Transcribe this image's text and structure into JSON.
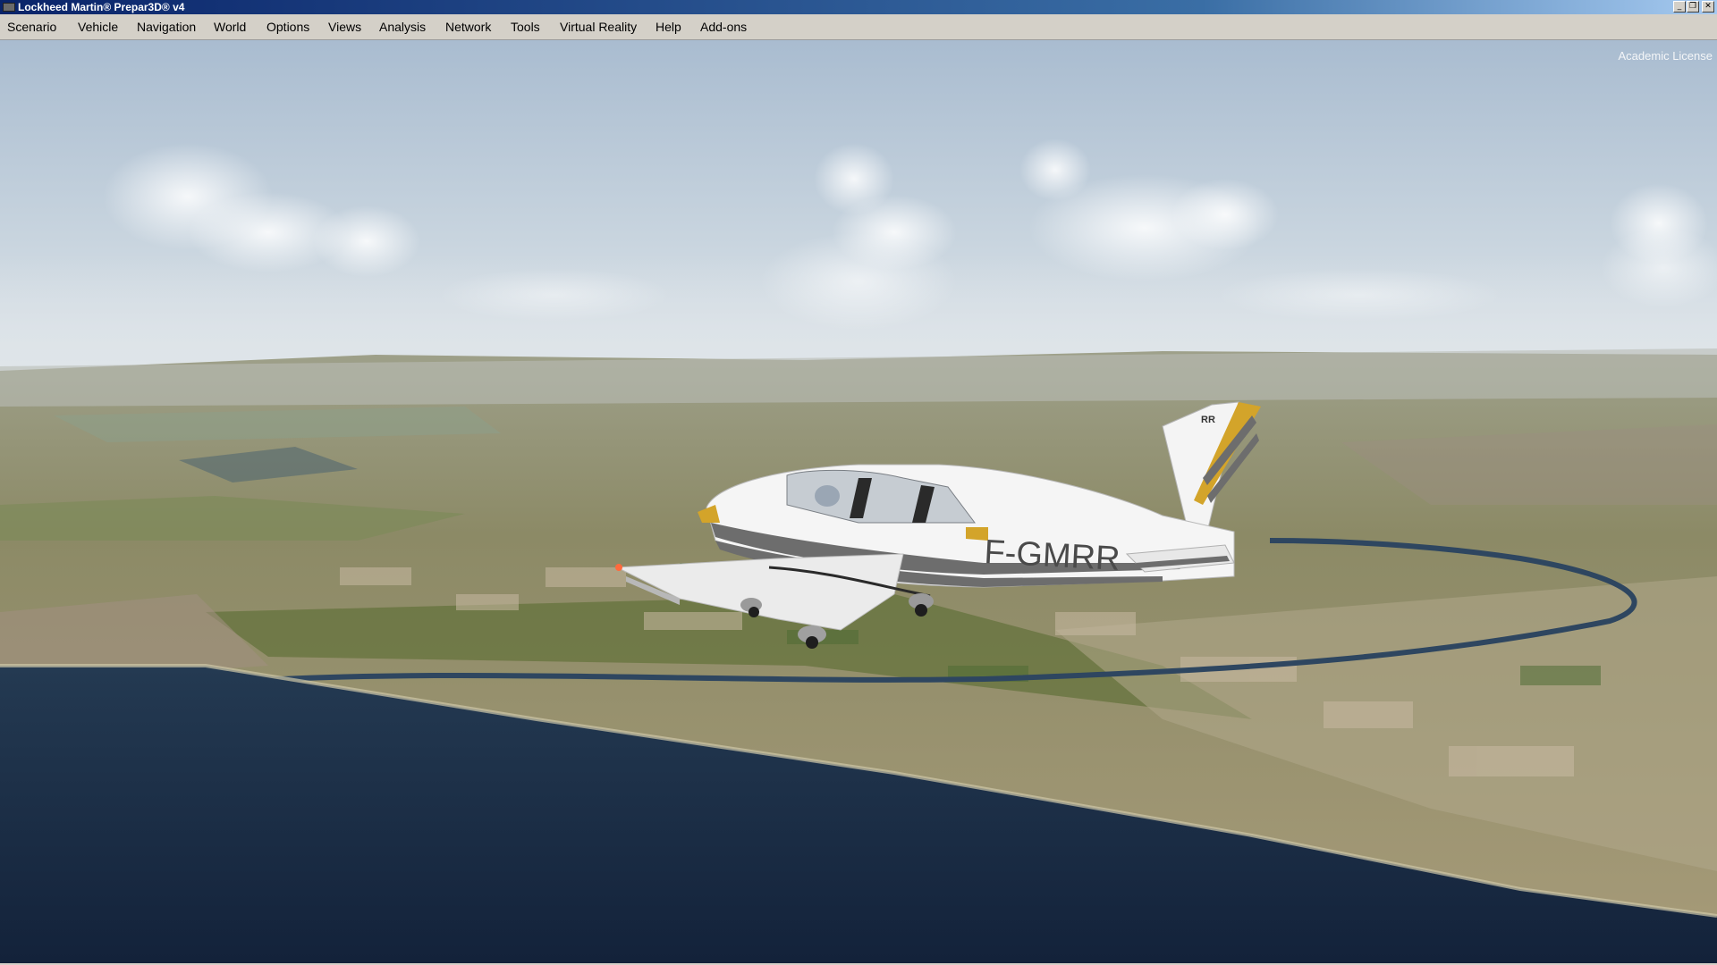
{
  "window": {
    "title": "Lockheed Martin® Prepar3D® v4",
    "icon": "p3d-app-icon",
    "controls": [
      {
        "name": "minimize-button",
        "glyph": "_"
      },
      {
        "name": "restore-button",
        "glyph": "❐"
      },
      {
        "name": "close-button",
        "glyph": "✕"
      }
    ]
  },
  "menubar": {
    "items": [
      "Scenario",
      "Vehicle",
      "Navigation",
      "World",
      "Options",
      "Views",
      "Analysis",
      "Network",
      "Tools",
      "Virtual Reality",
      "Help",
      "Add-ons"
    ]
  },
  "overlay": {
    "license": "Academic License"
  },
  "scene": {
    "aircraft_registration": "F-GMRR",
    "tail_marking": "RR",
    "colors": {
      "sky_top": "#aebfd0",
      "sky_horizon": "#dce4ea",
      "sea": "#1c2e42",
      "land": "#8d8b68",
      "stripe_gold": "#d3a42a",
      "stripe_grey": "#6d6d6d"
    }
  }
}
